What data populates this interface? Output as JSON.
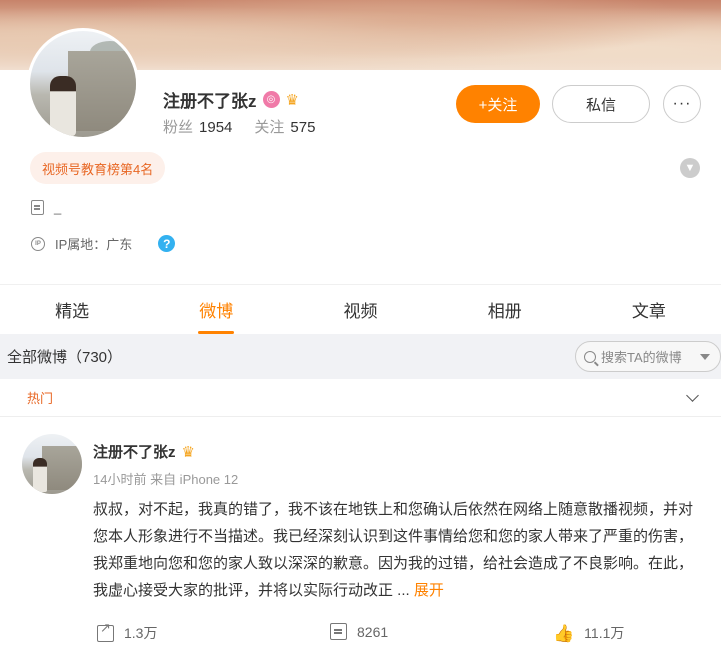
{
  "profile": {
    "name": "注册不了张z",
    "badge_icon": "verified-badge-icon",
    "crown_icon": "crown-icon",
    "fans_label": "粉丝",
    "fans_count": "1954",
    "following_label": "关注",
    "following_count": "575",
    "follow_button": "+关注",
    "message_button": "私信",
    "more_button": "···",
    "rank_tag": "视频号教育榜第4名",
    "bio": "_",
    "ip_location": "IP属地：广东"
  },
  "tabs": [
    {
      "label": "精选",
      "active": false
    },
    {
      "label": "微博",
      "active": true
    },
    {
      "label": "视频",
      "active": false
    },
    {
      "label": "相册",
      "active": false
    },
    {
      "label": "文章",
      "active": false
    }
  ],
  "filter": {
    "title": "全部微博（730）",
    "search_placeholder": "搜索TA的微博"
  },
  "feed": {
    "section_label": "热门",
    "post": {
      "author": "注册不了张z",
      "meta": "14小时前 来自 iPhone 12",
      "text": "叔叔，对不起，我真的错了，我不该在地铁上和您确认后依然在网络上随意散播视频，并对您本人形象进行不当描述。我已经深刻认识到这件事情给您和您的家人带来了严重的伤害，我郑重地向您和您的家人致以深深的歉意。因为我的过错，给社会造成了不良影响。在此，我虚心接受大家的批评，并将以实际行动改正 ...",
      "expand": "展开",
      "shares": "1.3万",
      "comments": "8261",
      "likes": "11.1万"
    }
  },
  "colors": {
    "accent": "#ff8200",
    "tag_text": "#e86724",
    "help_blue": "#33b1f0"
  }
}
